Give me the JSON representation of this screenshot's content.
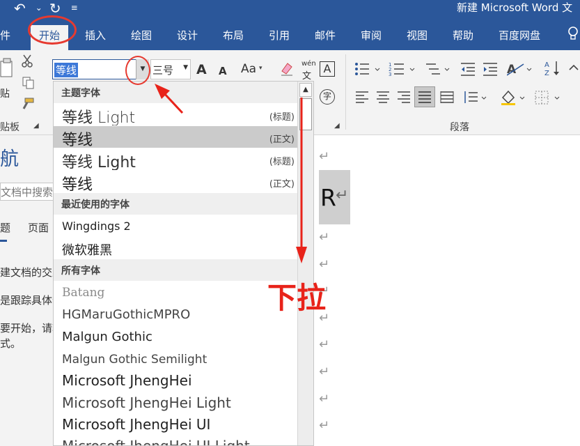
{
  "window": {
    "title": "新建 Microsoft Word 文"
  },
  "qat": {
    "undo_icon": "↶",
    "dropdown_caret": "⌄",
    "redo_icon": "↻",
    "customize_icon": "≡"
  },
  "tabs": [
    {
      "label": "件"
    },
    {
      "label": "开始"
    },
    {
      "label": "插入"
    },
    {
      "label": "绘图"
    },
    {
      "label": "设计"
    },
    {
      "label": "布局"
    },
    {
      "label": "引用"
    },
    {
      "label": "邮件"
    },
    {
      "label": "审阅"
    },
    {
      "label": "视图"
    },
    {
      "label": "帮助"
    },
    {
      "label": "百度网盘"
    }
  ],
  "ribbon": {
    "paste_label": "贴",
    "clipboard_label": "贴板",
    "font_name": "等线",
    "font_size": "三号",
    "grow_font": "A",
    "shrink_font": "A",
    "case_label": "Aa",
    "phonetic_top": "wén",
    "phonetic_bottom": "文",
    "char_border": "A",
    "enclose_char": "字",
    "paragraph_label": "段落"
  },
  "nav": {
    "title": "航",
    "search_placeholder": "文档中搜索",
    "tab_headings": "题",
    "tab_pages": "页面",
    "line1": "建文档的交互",
    "line2": "是跟踪具体位",
    "line3": "要开始，请转",
    "line4": "式。"
  },
  "document": {
    "r_char": "R",
    "para_mark": "↵"
  },
  "dropdown": {
    "section_theme": "主题字体",
    "section_recent": "最近使用的字体",
    "section_all": "所有字体",
    "theme_fonts": [
      {
        "name": "等线 Light",
        "tag": "(标题)"
      },
      {
        "name": "等线",
        "tag": "(正文)"
      },
      {
        "name": "等线 Light",
        "tag": "(标题)"
      },
      {
        "name": "等线",
        "tag": "(正文)"
      }
    ],
    "recent_fonts": [
      {
        "name": "Wingdings 2"
      },
      {
        "name": "微软雅黑"
      }
    ],
    "all_fonts": [
      {
        "name": "Batang"
      },
      {
        "name": "HGMaruGothicMPRO"
      },
      {
        "name": "Malgun Gothic"
      },
      {
        "name": "Malgun Gothic Semilight"
      },
      {
        "name": "Microsoft JhengHei"
      },
      {
        "name": "Microsoft JhengHei Light"
      },
      {
        "name": "Microsoft JhengHei UI"
      },
      {
        "name": "Microsoft JhengHei UI Light"
      }
    ]
  },
  "annotation": {
    "text": "下拉",
    "color": "#e8231a"
  },
  "colors": {
    "accent": "#2b579a",
    "selection": "#3c78d8"
  }
}
